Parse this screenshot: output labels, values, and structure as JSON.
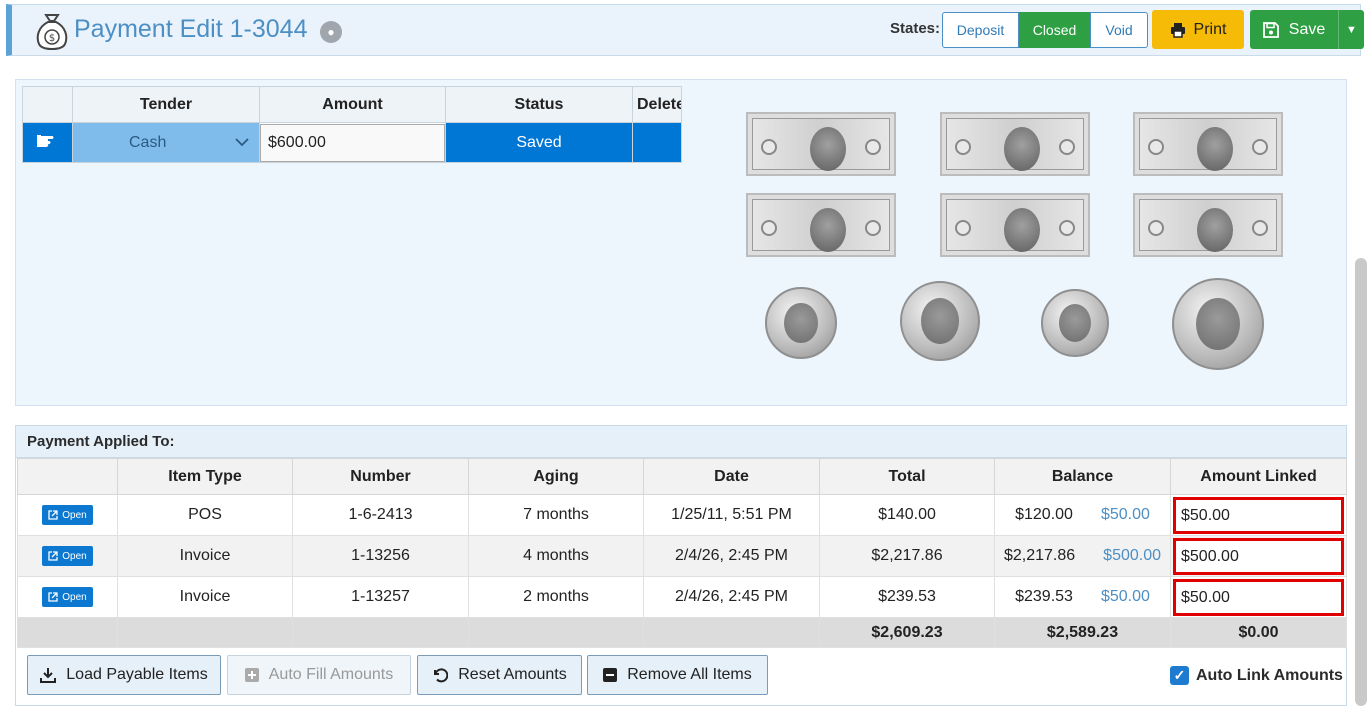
{
  "header": {
    "title": "Payment Edit 1-3044",
    "states_label": "States:",
    "states": [
      "Deposit",
      "Closed",
      "Void"
    ],
    "active_state": "Closed",
    "print_label": "Print",
    "save_label": "Save",
    "colors": {
      "accent": "#4c8fc4",
      "active_state": "#2ea043",
      "print": "#f6bb07",
      "save": "#2ea043"
    }
  },
  "tender_table": {
    "columns": [
      "Tender",
      "Amount",
      "Status",
      "Delete"
    ],
    "rows": [
      {
        "tender": "Cash",
        "amount": "$600.00",
        "status": "Saved"
      }
    ]
  },
  "applied": {
    "title": "Payment Applied To:",
    "columns": [
      "",
      "Item Type",
      "Number",
      "Aging",
      "Date",
      "Total",
      "Balance",
      "Amount Linked"
    ],
    "open_label": "Open",
    "rows": [
      {
        "type": "POS",
        "number": "1-6-2413",
        "aging": "7 months",
        "date": "1/25/11, 5:51 PM",
        "total": "$140.00",
        "balance": "$120.00",
        "balance_link": "$50.00",
        "linked": "$50.00"
      },
      {
        "type": "Invoice",
        "number": "1-13256",
        "aging": "4 months",
        "date": "2/4/26, 2:45 PM",
        "total": "$2,217.86",
        "balance": "$2,217.86",
        "balance_link": "$500.00",
        "linked": "$500.00"
      },
      {
        "type": "Invoice",
        "number": "1-13257",
        "aging": "2 months",
        "date": "2/4/26, 2:45 PM",
        "total": "$239.53",
        "balance": "$239.53",
        "balance_link": "$50.00",
        "linked": "$50.00"
      }
    ],
    "totals": {
      "total": "$2,609.23",
      "balance": "$2,589.23",
      "linked": "$0.00"
    }
  },
  "buttons": {
    "load_payable": "Load Payable Items",
    "auto_fill": "Auto Fill Amounts",
    "reset": "Reset Amounts",
    "remove_all": "Remove All Items",
    "auto_link": "Auto Link Amounts"
  }
}
